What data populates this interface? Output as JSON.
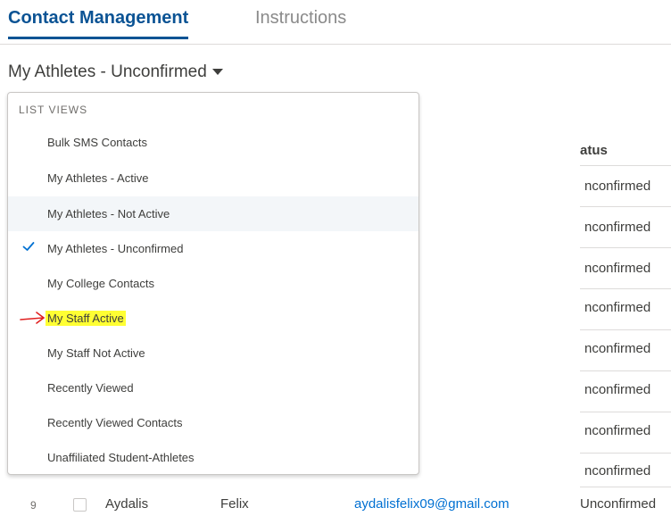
{
  "tabs": {
    "active": "Contact Management",
    "inactive": "Instructions"
  },
  "list_view": {
    "title": "My Athletes - Unconfirmed"
  },
  "dropdown": {
    "header": "LIST VIEWS",
    "items": [
      {
        "label": "Bulk SMS Contacts"
      },
      {
        "label": "My Athletes - Active"
      },
      {
        "label": "My Athletes - Not Active"
      },
      {
        "label": "My Athletes - Unconfirmed"
      },
      {
        "label": "My College Contacts"
      },
      {
        "label": "My Staff Active"
      },
      {
        "label": "My Staff Not Active"
      },
      {
        "label": "Recently Viewed"
      },
      {
        "label": "Recently Viewed Contacts"
      },
      {
        "label": "Unaffiliated Student-Athletes"
      }
    ]
  },
  "table": {
    "status_header_visible": "atus",
    "status_cells_visible": [
      "nconfirmed",
      "nconfirmed",
      "nconfirmed",
      "nconfirmed",
      "nconfirmed",
      "nconfirmed",
      "nconfirmed",
      "nconfirmed"
    ],
    "last_row": {
      "num": "9",
      "first_name": "Aydalis",
      "last_name": "Felix",
      "email": "aydalisfelix09@gmail.com",
      "status": "Unconfirmed"
    }
  },
  "colors": {
    "brand_blue": "#0b5394",
    "link_blue": "#0070d2",
    "highlight": "#ffff33",
    "annotation_arrow": "#e02020"
  }
}
